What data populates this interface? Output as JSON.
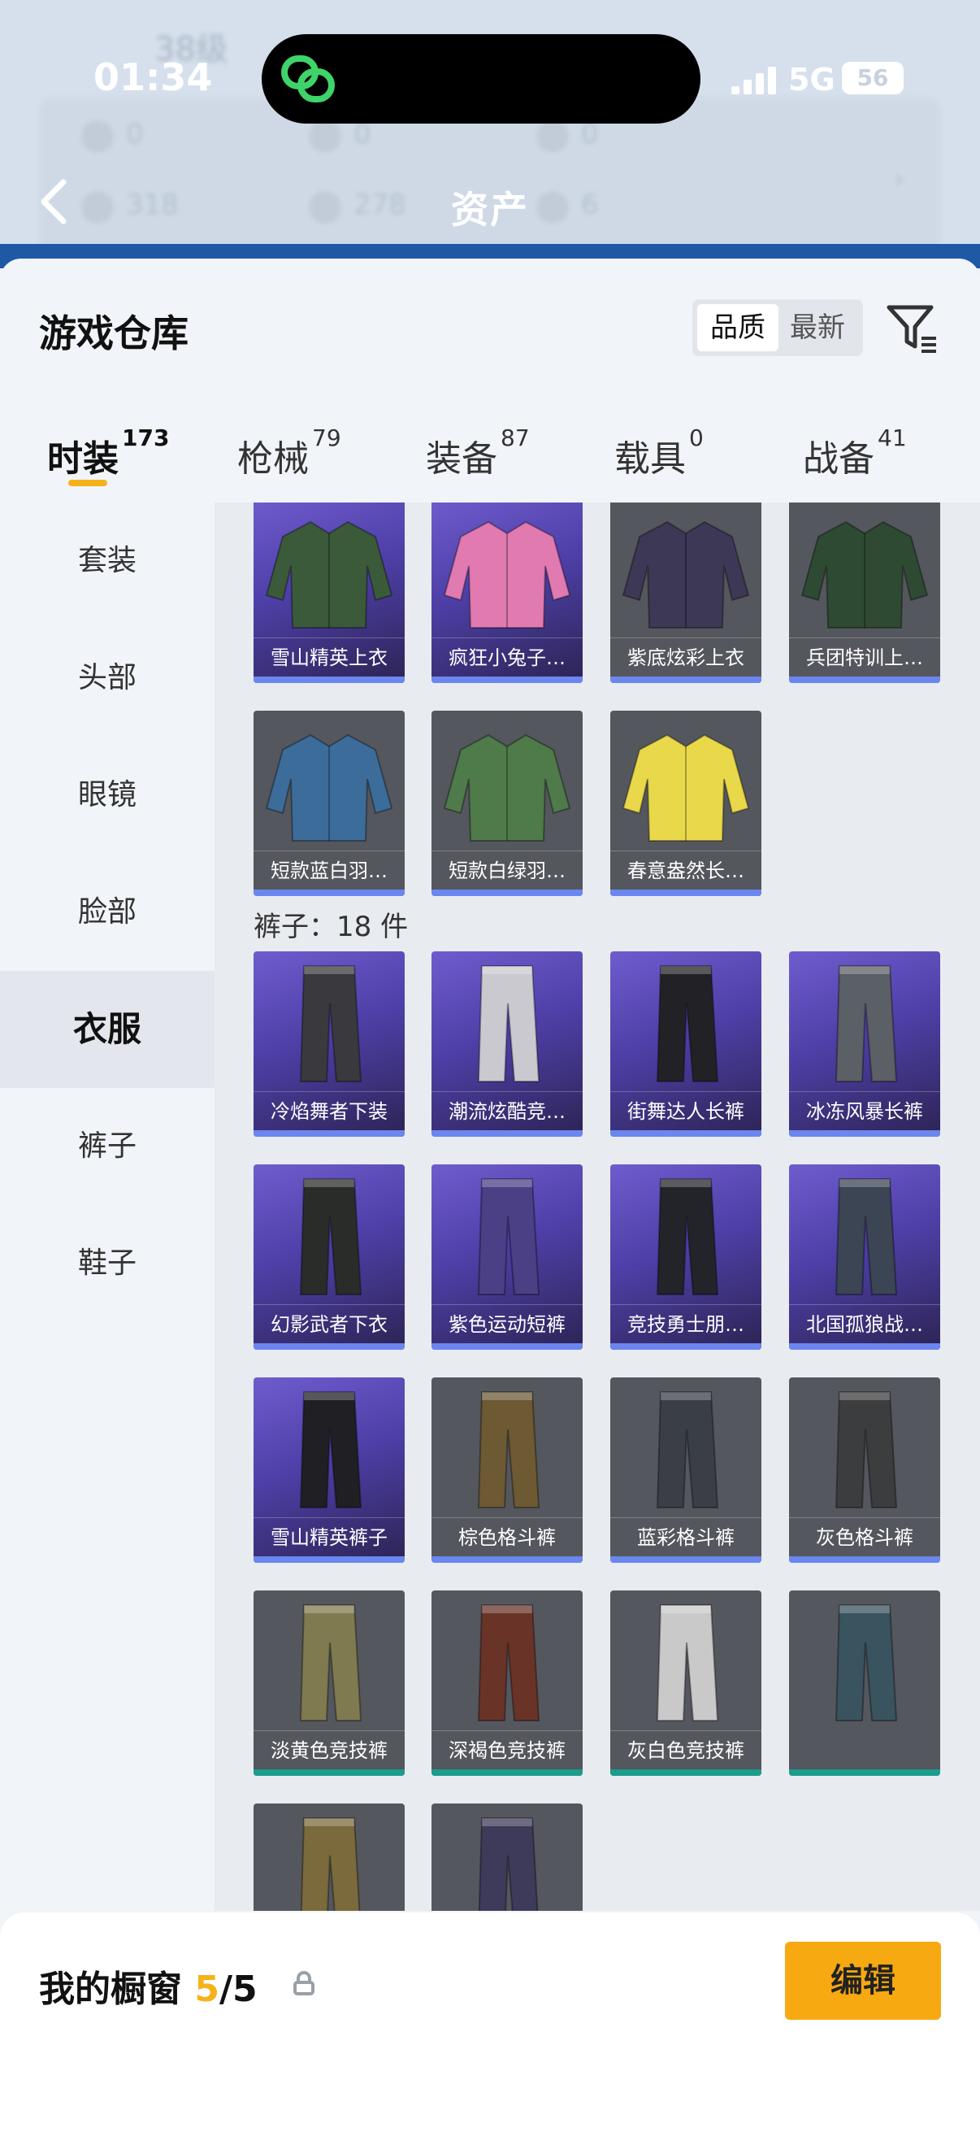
{
  "status": {
    "time": "01:34",
    "network": "5G",
    "battery": "56"
  },
  "background": {
    "level": "38级",
    "page_title": "资产",
    "stats": [
      "0",
      "0",
      "0",
      "318",
      "278",
      "6"
    ]
  },
  "sheet": {
    "title": "游戏仓库",
    "sort": {
      "quality": "品质",
      "newest": "最新"
    }
  },
  "tabs": [
    {
      "label": "时装",
      "count": "173"
    },
    {
      "label": "枪械",
      "count": "79"
    },
    {
      "label": "装备",
      "count": "87"
    },
    {
      "label": "载具",
      "count": "0"
    },
    {
      "label": "战备",
      "count": "41"
    }
  ],
  "categories": [
    "套装",
    "头部",
    "眼镜",
    "脸部",
    "衣服",
    "裤子",
    "鞋子"
  ],
  "active_category": "衣服",
  "tops": [
    {
      "name": "雪山精英上衣",
      "bg": "purple",
      "color": "#3b5a3a"
    },
    {
      "name": "疯狂小兔子…",
      "bg": "purple",
      "color": "#e17ab0"
    },
    {
      "name": "紫底炫彩上衣",
      "bg": "gray",
      "color": "#3c3856"
    },
    {
      "name": "兵团特训上…",
      "bg": "gray",
      "color": "#2f4a33"
    },
    {
      "name": "短款蓝白羽…",
      "bg": "gray",
      "color": "#3c6d9a"
    },
    {
      "name": "短款白绿羽…",
      "bg": "gray",
      "color": "#4f7a4a"
    },
    {
      "name": "春意盎然长…",
      "bg": "gray",
      "color": "#e9d94a"
    }
  ],
  "pants_header": "裤子：18 件",
  "pants": [
    {
      "name": "冷焰舞者下装",
      "bg": "purple",
      "color": "#3a3a3e",
      "rarity": "blue"
    },
    {
      "name": "潮流炫酷竞…",
      "bg": "purple",
      "color": "#c9c9cf",
      "rarity": "blue"
    },
    {
      "name": "街舞达人长裤",
      "bg": "purple",
      "color": "#222226",
      "rarity": "blue"
    },
    {
      "name": "冰冻风暴长裤",
      "bg": "purple",
      "color": "#5b5f66",
      "rarity": "blue"
    },
    {
      "name": "幻影武者下衣",
      "bg": "purple",
      "color": "#2a2c2a",
      "rarity": "blue"
    },
    {
      "name": "紫色运动短裤",
      "bg": "purple",
      "color": "#4b3f86",
      "rarity": "blue"
    },
    {
      "name": "竞技勇士朋…",
      "bg": "purple",
      "color": "#23232a",
      "rarity": "blue"
    },
    {
      "name": "北国孤狼战…",
      "bg": "purple",
      "color": "#3b4554",
      "rarity": "blue"
    },
    {
      "name": "雪山精英裤子",
      "bg": "purple",
      "color": "#1f1f24",
      "rarity": "blue"
    },
    {
      "name": "棕色格斗裤",
      "bg": "gray",
      "color": "#6d5a32",
      "rarity": "blue"
    },
    {
      "name": "蓝彩格斗裤",
      "bg": "gray",
      "color": "#3a3f47",
      "rarity": "blue"
    },
    {
      "name": "灰色格斗裤",
      "bg": "gray",
      "color": "#3c3d3e",
      "rarity": "blue"
    },
    {
      "name": "淡黄色竞技裤",
      "bg": "gray",
      "color": "#7f7a4f",
      "rarity": "teal"
    },
    {
      "name": "深褐色竞技裤",
      "bg": "gray",
      "color": "#6a3328",
      "rarity": "teal"
    },
    {
      "name": "灰白色竞技裤",
      "bg": "gray",
      "color": "#c9c9c9",
      "rarity": "teal"
    },
    {
      "name": "",
      "bg": "gray",
      "color": "#39535f",
      "rarity": "teal"
    },
    {
      "name": "",
      "bg": "gray",
      "color": "#7a6a3c",
      "rarity": "none"
    },
    {
      "name": "",
      "bg": "gray",
      "color": "#3e3a5a",
      "rarity": "none"
    }
  ],
  "bottom": {
    "label": "我的橱窗",
    "current": "5",
    "total": "/5",
    "edit": "编辑"
  },
  "colors": {
    "accent": "#f6b21a",
    "purple_card": "#5646b0",
    "gray_card": "#55575e"
  }
}
